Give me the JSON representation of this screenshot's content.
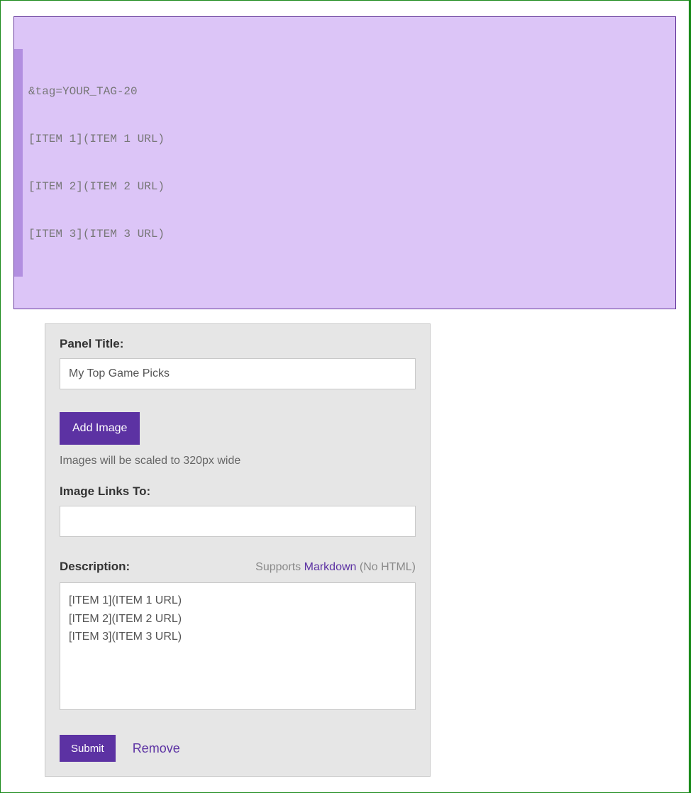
{
  "code": {
    "lines": [
      "&tag=YOUR_TAG-20",
      "[ITEM 1](ITEM 1 URL)",
      "[ITEM 2](ITEM 2 URL)",
      "[ITEM 3](ITEM 3 URL)"
    ]
  },
  "panel": {
    "title_label": "Panel Title:",
    "title_value": "My Top Game Picks",
    "add_image_label": "Add Image",
    "image_hint": "Images will be scaled to 320px wide",
    "links_to_label": "Image Links To:",
    "links_to_value": "",
    "description_label": "Description:",
    "supports_prefix": "Supports ",
    "markdown_word": "Markdown",
    "supports_suffix": " (No HTML)",
    "description_value": "[ITEM 1](ITEM 1 URL)\n[ITEM 2](ITEM 2 URL)\n[ITEM 3](ITEM 3 URL)",
    "submit_label": "Submit",
    "remove_label": "Remove"
  }
}
